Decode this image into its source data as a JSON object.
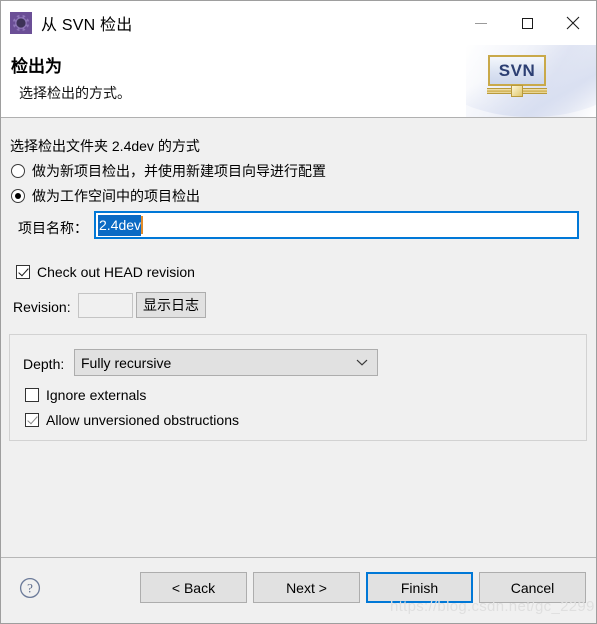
{
  "window": {
    "title": "从 SVN 检出",
    "icon": "svn-gear-icon",
    "controls": {
      "minimize": "minimize-icon",
      "maximize": "maximize-icon",
      "close": "close-icon"
    }
  },
  "header": {
    "title": "检出为",
    "subtitle": "选择检出的方式。",
    "logo_text": "SVN"
  },
  "main": {
    "prompt": "选择检出文件夹 2.4dev 的方式",
    "radios": [
      {
        "label": "做为新项目检出，并使用新建项目向导进行配置",
        "checked": false
      },
      {
        "label": "做为工作空间中的项目检出",
        "checked": true
      }
    ],
    "project_name": {
      "label": "项目名称：",
      "value": "2.4dev",
      "selected": true,
      "focused": true
    },
    "head_revision": {
      "label": "Check out HEAD revision",
      "checked": true
    },
    "revision": {
      "label": "Revision:",
      "value": "",
      "disabled": true
    },
    "show_log_button": "显示日志",
    "depth_group": {
      "depth_label": "Depth:",
      "depth_value": "Fully recursive",
      "depth_options": [
        "Fully recursive"
      ],
      "options": [
        {
          "label": "Ignore externals",
          "checked": false
        },
        {
          "label": "Allow unversioned obstructions",
          "checked": true
        }
      ]
    }
  },
  "footer": {
    "help": "help-icon",
    "buttons": [
      {
        "label": "< Back",
        "default": false
      },
      {
        "label": "Next >",
        "default": false
      },
      {
        "label": "Finish",
        "default": true
      },
      {
        "label": "Cancel",
        "default": false
      }
    ]
  },
  "watermark": "https://blog.csdn.net/gc_2299",
  "colors": {
    "accent": "#0078d7",
    "selection": "#0a6ac4",
    "caret": "#e08b2a",
    "window_bg": "#f0f0f0",
    "header_bg": "#ffffff"
  }
}
